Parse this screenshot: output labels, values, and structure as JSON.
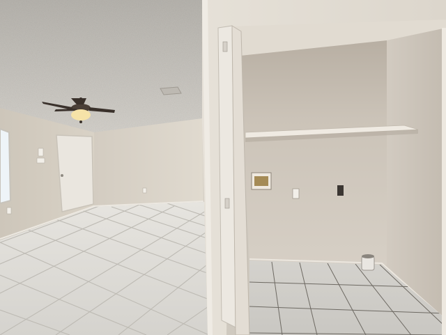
{
  "scene": {
    "description_kind": "photo",
    "colors": {
      "ceiling": "#c9c6c0",
      "wall_left": "#d8d2c7",
      "wall_back": "#d9d3c8",
      "partition_wall": "#e3ddd3",
      "closet_interior": "#cbc3b8",
      "closet_shadow": "#b9b1a6",
      "tile": "#dcdad5",
      "tile_grout": "#bdbab3",
      "door": "#ece8e1",
      "window": "#eaf2f8",
      "fan_blade": "#3a312b",
      "fan_light": "#f6e3a8"
    }
  }
}
